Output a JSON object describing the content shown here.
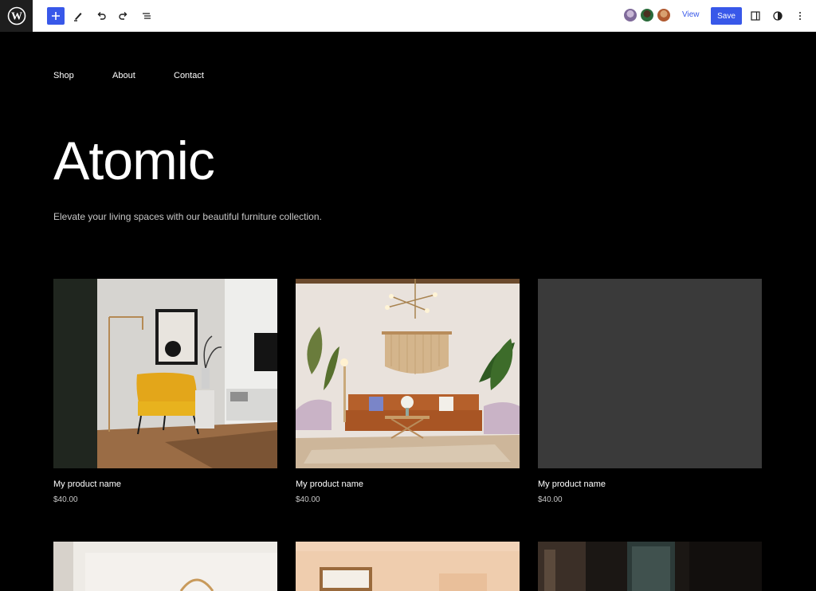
{
  "toolbar": {
    "add_icon": "plus-icon",
    "tools_icon": "pencil-icon",
    "undo_icon": "undo-icon",
    "redo_icon": "redo-icon",
    "list_view_icon": "list-view-icon",
    "view_label": "View",
    "save_label": "Save",
    "settings_icon": "sidebar-toggle-icon",
    "styles_icon": "half-circle-icon",
    "more_icon": "more-vertical-icon"
  },
  "nav": {
    "items": [
      "Shop",
      "About",
      "Contact"
    ]
  },
  "site": {
    "title": "Atomic",
    "tagline": "Elevate your living spaces with our beautiful furniture collection."
  },
  "products": [
    {
      "name": "My product name",
      "price": "$40.00"
    },
    {
      "name": "My product name",
      "price": "$40.00"
    },
    {
      "name": "My product name",
      "price": "$40.00"
    }
  ],
  "colors": {
    "accent": "#3858e9",
    "background": "#000000",
    "placeholder": "#3a3a3a"
  }
}
